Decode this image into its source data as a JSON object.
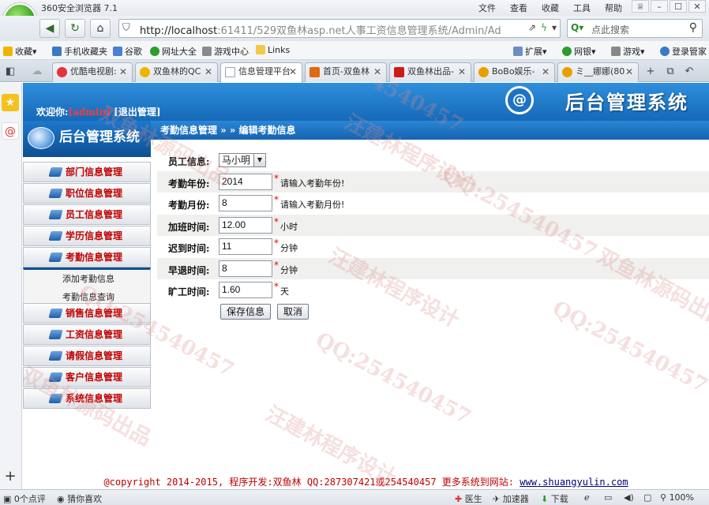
{
  "browser": {
    "title": "360安全浏览器 7.1",
    "menus": [
      "文件",
      "查看",
      "收藏",
      "工具",
      "帮助"
    ],
    "url_host": "http://localhost",
    "url_rest": ":61411/529双鱼林asp.net人事工资信息管理系统/Admin/Ad",
    "search_placeholder": "点此搜索",
    "favorites": [
      "收藏",
      "手机收藏夹",
      "谷歌",
      "网址大全",
      "游戏中心",
      "Links"
    ],
    "fav_right": [
      "扩展",
      "网银",
      "游戏",
      "登录管家"
    ],
    "tabs": [
      {
        "label": "优酷电视剧:",
        "color": "#e0353a",
        "active": false
      },
      {
        "label": "双鱼林的QC",
        "color": "#f0b400",
        "active": false
      },
      {
        "label": "信息管理平台",
        "color": "#9aa4b0",
        "active": true
      },
      {
        "label": "首页-双鱼林",
        "color": "#e06a10",
        "active": false
      },
      {
        "label": "双鱼林出品-",
        "color": "#d01a1a",
        "active": false
      },
      {
        "label": "BoBo娱乐-",
        "color": "#e8a000",
        "active": false
      },
      {
        "label": "ミ__娜娜(80",
        "color": "#e8a000",
        "active": false
      }
    ],
    "status": {
      "comments": "0个点评",
      "guess": "猜你喜欢",
      "doctor": "医生",
      "accelerator": "加速器",
      "download": "下载",
      "zoom": "100%"
    }
  },
  "banner": {
    "welcome_prefix": "欢迎你:",
    "user": "[admin]",
    "logout": "[退出管理]",
    "system_name": "后台管理系统",
    "emblem": "@"
  },
  "sidebar": {
    "header": "后台管理系统",
    "items_top": [
      "部门信息管理",
      "职位信息管理",
      "员工信息管理",
      "学历信息管理",
      "考勤信息管理"
    ],
    "submenu": [
      "添加考勤信息",
      "考勤信息查询"
    ],
    "items_bottom": [
      "销售信息管理",
      "工资信息管理",
      "请假信息管理",
      "客户信息管理",
      "系统信息管理"
    ]
  },
  "breadcrumb": "考勤信息管理 » » 编辑考勤信息",
  "form": {
    "employee": {
      "label": "员工信息:",
      "value": "马小明"
    },
    "year": {
      "label": "考勤年份:",
      "value": "2014",
      "hint": "请输入考勤年份!"
    },
    "month": {
      "label": "考勤月份:",
      "value": "8",
      "hint": "请输入考勤月份!"
    },
    "overtime": {
      "label": "加班时间:",
      "value": "12.00",
      "hint": "小时"
    },
    "late": {
      "label": "迟到时间:",
      "value": "11",
      "hint": "分钟"
    },
    "early": {
      "label": "早退时间:",
      "value": "8",
      "hint": "分钟"
    },
    "absent": {
      "label": "旷工时间:",
      "value": "1.60",
      "hint": "天"
    },
    "save_label": "保存信息",
    "cancel_label": "取消"
  },
  "footer": {
    "text": "@copyright 2014-2015, 程序开发:双鱼林  QQ:287307421或254540457  更多系统到网站:",
    "link": "www.shuangyulin.com"
  },
  "watermarks": [
    "QQ:254540457",
    "汪建林程序设计",
    "双鱼林源码出品"
  ]
}
